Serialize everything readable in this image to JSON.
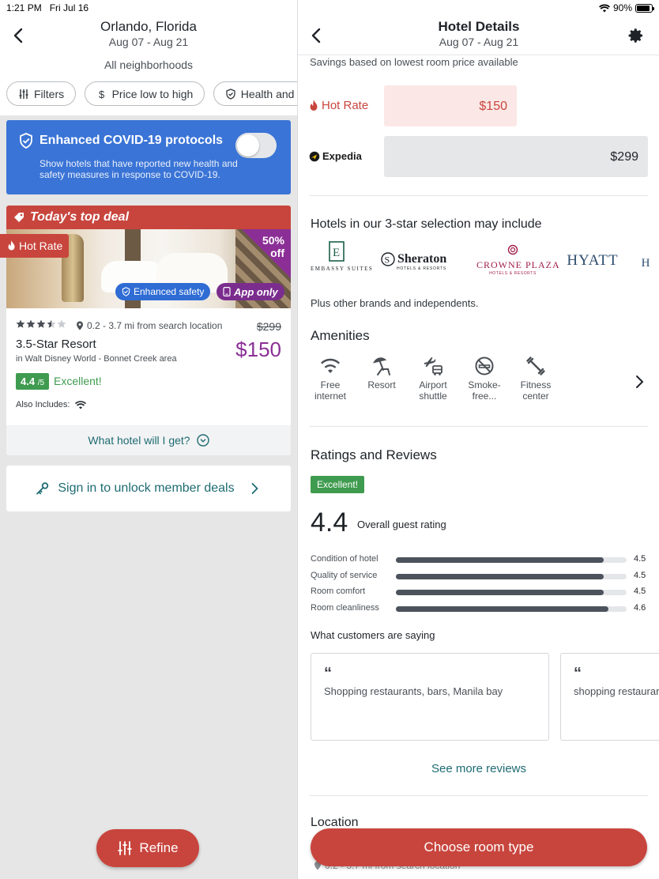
{
  "status": {
    "time": "1:21 PM",
    "date": "Fri Jul 16",
    "battery": "90%",
    "battery_level": 0.9
  },
  "search": {
    "destination": "Orlando, Florida",
    "dates": "Aug 07 - Aug 21",
    "neighborhoods": "All neighborhoods",
    "chips": [
      {
        "label": "Filters",
        "icon": "sliders-icon"
      },
      {
        "label": "Price low to high",
        "icon": "dollar-icon"
      },
      {
        "label": "Health and safety",
        "icon": "shield-icon"
      }
    ]
  },
  "covid": {
    "title": "Enhanced COVID-19 protocols",
    "description": "Show hotels that have reported new health and safety measures in response to COVID-19.",
    "enabled": false
  },
  "deal": {
    "banner": "Today's top deal",
    "hot_rate": "Hot Rate",
    "discount_pct": "50%",
    "discount_word": "off",
    "safety_badge": "Enhanced safety",
    "app_badge": "App only",
    "stars": 3.5,
    "distance": "0.2 - 3.7 mi from search location",
    "original_price": "$299",
    "title": "3.5-Star Resort",
    "area": "in Walt Disney World - Bonnet Creek area",
    "price": "$150",
    "rating": "4.4",
    "rating_max": "/5",
    "rating_label": "Excellent!",
    "also_includes": "Also Includes:",
    "what_hotel": "What hotel will I get?"
  },
  "sign_in": "Sign in to unlock member deals",
  "refine": "Refine",
  "details": {
    "title": "Hotel Details",
    "dates": "Aug 07 - Aug 21",
    "savings_note": "Savings based on lowest room price available",
    "hot_rate_label": "Hot Rate",
    "hot_rate_price": "$150",
    "expedia_label": "Expedia",
    "expedia_price": "$299",
    "brands_title": "Hotels in our 3-star selection may include",
    "brands": [
      "EMBASSY SUITES",
      "Sheraton",
      "CROWNE PLAZA",
      "HYATT"
    ],
    "brand_subs": {
      "sheraton": "HOTELS & RESORTS",
      "crowne": "HOTELS & RESORTS"
    },
    "plus_other": "Plus other brands and independents.",
    "amenities_title": "Amenities",
    "amenities": [
      {
        "label": "Free internet",
        "icon": "wifi-icon"
      },
      {
        "label": "Resort",
        "icon": "beach-chair-icon"
      },
      {
        "label": "Airport shuttle",
        "icon": "airport-shuttle-icon"
      },
      {
        "label": "Smoke-free...",
        "icon": "no-smoking-icon"
      },
      {
        "label": "Fitness center",
        "icon": "dumbbell-icon"
      }
    ],
    "ratings_title": "Ratings and Reviews",
    "excellent_badge": "Excellent!",
    "overall": "4.4",
    "overall_label": "Overall guest rating",
    "ratings": [
      {
        "label": "Condition of hotel",
        "value": "4.5",
        "score": 4.5
      },
      {
        "label": "Quality of service",
        "value": "4.5",
        "score": 4.5
      },
      {
        "label": "Room comfort",
        "value": "4.5",
        "score": 4.5
      },
      {
        "label": "Room cleanliness",
        "value": "4.6",
        "score": 4.6
      }
    ],
    "customers_title": "What customers are saying",
    "reviews": [
      "Shopping restaurants, bars, Manila bay",
      "shopping restaurants"
    ],
    "see_more": "See more reviews",
    "location_title": "Location",
    "location_sub": "0.2 - 3.7 mi from search location",
    "choose": "Choose room type"
  },
  "colors": {
    "accent_red": "#c8453d",
    "teal": "#1e6b73",
    "purple": "#8b2f96",
    "green": "#3f9b4f",
    "blue": "#3a74d6"
  }
}
